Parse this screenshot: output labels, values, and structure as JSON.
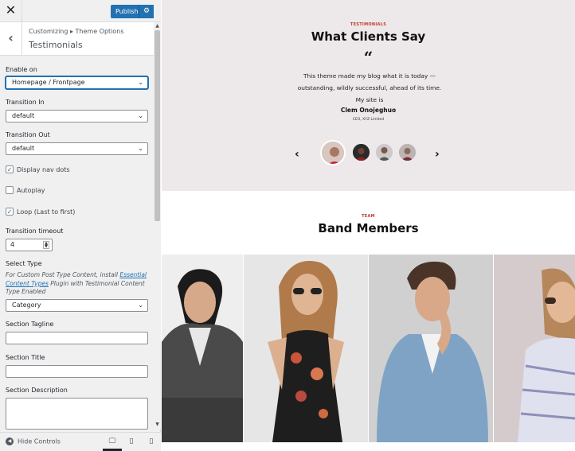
{
  "topbar": {
    "close_label": "✕",
    "publish_label": "Publish",
    "settings_icon": "gear-icon"
  },
  "header": {
    "back_icon": "chevron-left-icon",
    "breadcrumb": "Customizing ▸ Theme Options",
    "section_title": "Testimonials"
  },
  "controls": {
    "enable_on": {
      "label": "Enable on",
      "value": "Homepage / Frontpage"
    },
    "transition_in": {
      "label": "Transition In",
      "value": "default"
    },
    "transition_out": {
      "label": "Transition Out",
      "value": "default"
    },
    "display_nav_dots": {
      "label": "Display nav dots",
      "checked": true
    },
    "autoplay": {
      "label": "Autoplay",
      "checked": false
    },
    "loop": {
      "label": "Loop (Last to first)",
      "checked": true
    },
    "transition_timeout": {
      "label": "Transition timeout",
      "value": "4"
    },
    "select_type": {
      "label": "Select Type",
      "desc_before": "For Custom Post Type Content, install ",
      "desc_link": "Essential Content Types",
      "desc_after": " Plugin with Testimonial Content Type Enabled",
      "value": "Category"
    },
    "section_tagline": {
      "label": "Section Tagline",
      "value": ""
    },
    "section_title": {
      "label": "Section Title",
      "value": ""
    },
    "section_description": {
      "label": "Section Description",
      "value": ""
    }
  },
  "footer": {
    "hide_controls_label": "Hide Controls",
    "devices": [
      "desktop-icon",
      "tablet-icon",
      "mobile-icon"
    ]
  },
  "preview": {
    "testimonials": {
      "tagline": "TESTIMONIALS",
      "title": "What Clients Say",
      "quote_mark": "“",
      "quote": "This theme made my blog what it is today — outstanding, wildly successful, ahead of its time. My site is",
      "author": "Clem Onojeghuo",
      "role": "CEO, XYZ Limited",
      "prev": "‹",
      "next": "›"
    },
    "team": {
      "tagline": "TEAM",
      "title": "Band Members"
    }
  },
  "colors": {
    "accent": "#2271b1",
    "tagline_red": "#c0392b",
    "testimonial_bg": "#ede8ea"
  }
}
